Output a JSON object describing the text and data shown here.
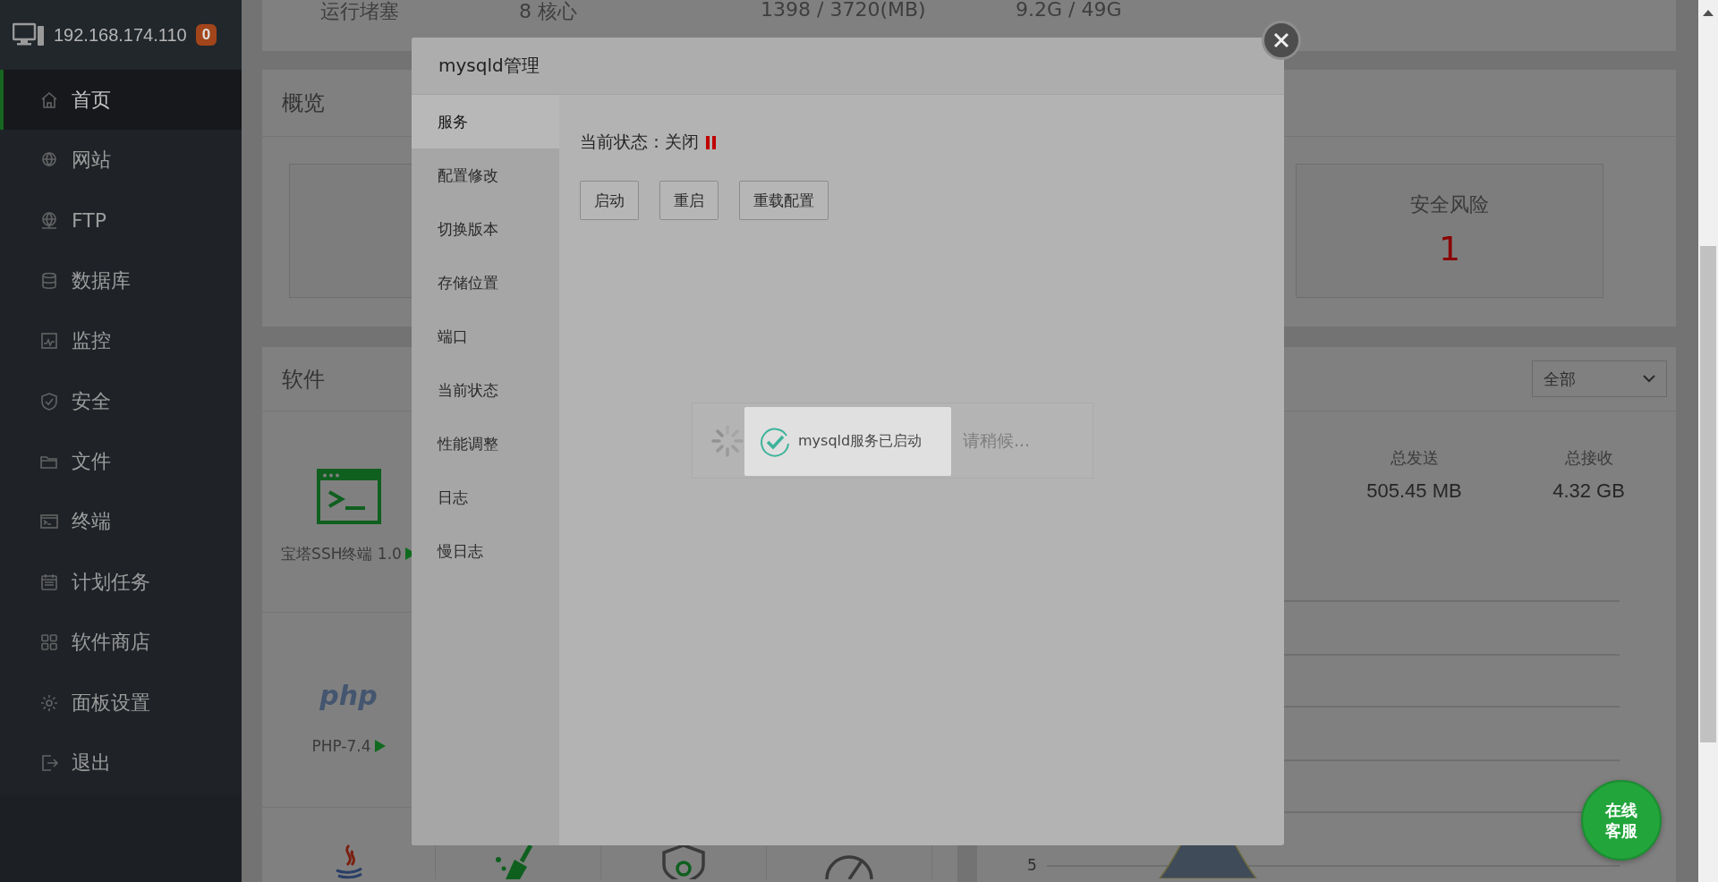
{
  "sidebar": {
    "host": "192.168.174.110",
    "badge": "0",
    "items": [
      {
        "label": "首页",
        "kind": "home",
        "selected": true
      },
      {
        "label": "网站",
        "kind": "globe",
        "selected": false
      },
      {
        "label": "FTP",
        "kind": "ftp",
        "selected": false
      },
      {
        "label": "数据库",
        "kind": "database",
        "selected": false
      },
      {
        "label": "监控",
        "kind": "monitor",
        "selected": false
      },
      {
        "label": "安全",
        "kind": "shield",
        "selected": false
      },
      {
        "label": "文件",
        "kind": "folder",
        "selected": false
      },
      {
        "label": "终端",
        "kind": "terminal",
        "selected": false
      },
      {
        "label": "计划任务",
        "kind": "calendar",
        "selected": false
      },
      {
        "label": "软件商店",
        "kind": "grid",
        "selected": false
      },
      {
        "label": "面板设置",
        "kind": "gear",
        "selected": false
      },
      {
        "label": "退出",
        "kind": "exit",
        "selected": false
      }
    ]
  },
  "system_row": [
    "运行堵塞",
    "8 核心",
    "1398 / 3720(MB)",
    "9.2G / 49G"
  ],
  "overview": {
    "title": "概览",
    "stats": [
      {
        "kind": "empty"
      },
      {
        "kind": "covered"
      },
      {
        "kind": "covered"
      },
      {
        "kind": "shown",
        "label": "安全风险",
        "value": "1"
      }
    ]
  },
  "software": {
    "title": "软件",
    "items": [
      {
        "kind": "terminal",
        "label": "宝塔SSH终端 1.0"
      },
      {
        "kind": "php",
        "logo": "php",
        "label": "PHP-7.4"
      }
    ],
    "bottom_icons": [
      {
        "kind": "java"
      },
      {
        "kind": "broom"
      },
      {
        "kind": "shield"
      },
      {
        "kind": "gauge"
      }
    ]
  },
  "traffic": {
    "filter": "全部",
    "stats": [
      {
        "label": "总发送",
        "value": "505.45 MB"
      },
      {
        "label": "总接收",
        "value": "4.32 GB"
      }
    ],
    "axis_label": "5"
  },
  "modal": {
    "title": "mysqld管理",
    "menu": [
      {
        "label": "服务",
        "selected": true
      },
      {
        "label": "配置修改",
        "selected": false
      },
      {
        "label": "切换版本",
        "selected": false
      },
      {
        "label": "存储位置",
        "selected": false
      },
      {
        "label": "端口",
        "selected": false
      },
      {
        "label": "当前状态",
        "selected": false
      },
      {
        "label": "性能调整",
        "selected": false
      },
      {
        "label": "日志",
        "selected": false
      },
      {
        "label": "慢日志",
        "selected": false
      }
    ],
    "status_label": "当前状态：关闭",
    "running": false,
    "buttons": [
      "启动",
      "重启",
      "重载配置"
    ]
  },
  "loading": {
    "text": "请稍候..."
  },
  "toast": {
    "text": "mysqld服务已启动"
  },
  "chat_button": "在线客服"
}
